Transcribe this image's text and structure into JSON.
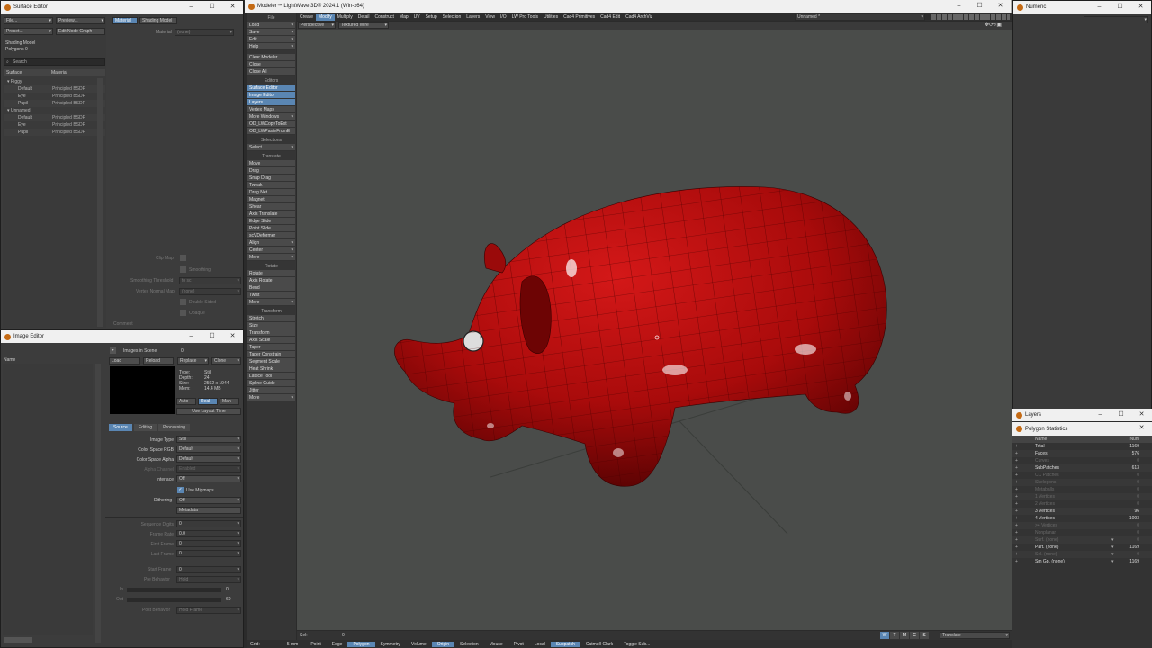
{
  "surface_editor": {
    "title": "Surface Editor",
    "file": "File...",
    "preview": "Preview...",
    "preset": "Preset...",
    "edit_node_graph": "Edit Node Graph",
    "shading_model": "Shading Model",
    "polygons": "Polygons  0",
    "search": "Search",
    "col_surface": "Surface",
    "col_material": "Material",
    "tab_material": "Material",
    "tab_shading": "Shading Model",
    "material_label": "Material",
    "material_value": "(none)",
    "tree": [
      {
        "label": "Piggy",
        "material": "",
        "indent": 0,
        "group": true
      },
      {
        "label": "Default",
        "material": "Principled BSDF",
        "indent": 1
      },
      {
        "label": "Eye",
        "material": "Principled BSDF",
        "indent": 1
      },
      {
        "label": "Pupil",
        "material": "Principled BSDF",
        "indent": 1
      },
      {
        "label": "Unnamed",
        "material": "",
        "indent": 0,
        "group": true
      },
      {
        "label": "Default",
        "material": "Principled BSDF",
        "indent": 1
      },
      {
        "label": "Eye",
        "material": "Principled BSDF",
        "indent": 1
      },
      {
        "label": "Pupil",
        "material": "Principled BSDF",
        "indent": 1
      }
    ],
    "clip_map": "Clip Map",
    "smoothing": "Smoothing",
    "smoothing_threshold": "Smoothing Threshold",
    "smoothing_threshold_val": "to sc",
    "vertex_normal_map": "Vertex Normal Map",
    "vertex_normal_val": "(none)",
    "double_sided": "Double Sided",
    "opaque": "Opaque",
    "comment": "Comment"
  },
  "image_editor": {
    "title": "Image Editor",
    "name_col": "Name",
    "images_in_scene": "Images in Scene",
    "count": "0",
    "load": "Load",
    "reload": "Reload",
    "replace": "Replace",
    "clone": "Clone",
    "type_k": "Type:",
    "type_v": "Still",
    "depth_k": "Depth:",
    "depth_v": "24",
    "size_k": "Size:",
    "size_v": "2592 x 1944",
    "mem_k": "Mem:",
    "mem_v": "14.4 MB",
    "auto": "Auto",
    "real": "Real",
    "man": "Man",
    "use_layout_time": "Use Layout Time",
    "tabs": [
      "Source",
      "Editing",
      "Processing"
    ],
    "fields": [
      {
        "label": "Image Type",
        "value": "Still"
      },
      {
        "label": "Color Space RGB",
        "value": "Default"
      },
      {
        "label": "Color Space Alpha",
        "value": "Default"
      },
      {
        "label": "Alpha Channel",
        "value": "Enabled"
      },
      {
        "label": "Interlace",
        "value": "Off"
      }
    ],
    "use_mipmaps": "Use Mipmaps",
    "dithering": "Dithering",
    "dithering_val": "Off",
    "metadata": "Metadata",
    "seq": [
      {
        "label": "Sequence Digits",
        "value": "0"
      },
      {
        "label": "Frame Rate",
        "value": "0.0"
      },
      {
        "label": "First Frame",
        "value": "0"
      },
      {
        "label": "Last Frame",
        "value": "0"
      }
    ],
    "start_frame": "Start Frame",
    "start_val": "0",
    "pre_behavior": "Pre Behavior",
    "pre_val": "Hold",
    "in_label": "In",
    "in_val": "0",
    "out_label": "Out",
    "out_val": "60",
    "post_behavior": "Post Behavior",
    "post_val": "Hold Frame"
  },
  "modeler": {
    "title": "Modeler™ LightWave 3D® 2024.1 (Win-x64)",
    "menus": [
      {
        "t": "Create"
      },
      {
        "t": "Modify",
        "sel": true
      },
      {
        "t": "Multiply"
      },
      {
        "t": "Detail"
      },
      {
        "t": "Construct"
      },
      {
        "t": "Map"
      },
      {
        "t": "UV"
      },
      {
        "t": "Setup"
      },
      {
        "t": "Selection"
      },
      {
        "t": "Layers"
      },
      {
        "t": "View"
      },
      {
        "t": "I/O"
      },
      {
        "t": "LW Pro Tools"
      },
      {
        "t": "Utilities"
      },
      {
        "t": "Cad4 Primitives"
      },
      {
        "t": "Cad4 Edit"
      },
      {
        "t": "Cad4 ArchViz"
      }
    ],
    "object_name": "Unnamed *",
    "view_mode": "Perspective",
    "shade_mode": "Textured Wire",
    "toolbar": {
      "file": "File",
      "file_items": [
        "Load",
        "Save",
        "Edit",
        "Help"
      ],
      "misc": [
        "Clear Modeler",
        "Close",
        "Close All"
      ],
      "editors_hdr": "Editors",
      "editors": [
        "Surface Editor",
        "Image Editor",
        "Layers",
        "Vertex Maps"
      ],
      "more_windows": "More Windows",
      "plugins": [
        "OD_LWCopyToExt",
        "OD_LWPasteFromE"
      ],
      "selections_hdr": "Selections",
      "select": "Select",
      "translate_hdr": "Translate",
      "translate": [
        "Move",
        "Drag",
        "Snap Drag",
        "Tweak",
        "Drag Net",
        "Magnet",
        "Shear",
        "Axis Translate",
        "Edge Slide",
        "Point Slide",
        "scVDeformer",
        "Align",
        "Center",
        "More"
      ],
      "rotate_hdr": "Rotate",
      "rotate": [
        "Rotate",
        "Axis Rotate",
        "Bend",
        "Twist",
        "More"
      ],
      "transform_hdr": "Transform",
      "transform": [
        "Stretch",
        "Size",
        "Transform",
        "Axis Scale",
        "Taper",
        "Taper Constrain",
        "Segment Scale",
        "Heat Shrink",
        "Lattice Tool",
        "Spline Guide",
        "Jitter",
        "More"
      ]
    },
    "sel_label": "Sel:",
    "sel_val": "0",
    "grid_label": "Grid:",
    "grid_val": "5 mm",
    "bottom": [
      {
        "t": "Point"
      },
      {
        "t": "Edge"
      },
      {
        "t": "Polygon",
        "sel": true
      },
      {
        "t": "Symmetry"
      },
      {
        "t": "Volume"
      },
      {
        "t": "Origin",
        "sel": true
      },
      {
        "t": "Selection"
      },
      {
        "t": "Mouse"
      },
      {
        "t": "Pivot"
      },
      {
        "t": "Local"
      },
      {
        "t": "Subpatch",
        "sel": true
      },
      {
        "t": "Catmull-Clark"
      },
      {
        "t": "Toggle Sub..."
      }
    ],
    "wtmcs": [
      "W",
      "T",
      "M",
      "C",
      "S"
    ],
    "bottom_right": "Translate"
  },
  "numeric": {
    "title": "Numeric"
  },
  "layers": {
    "title": "Layers"
  },
  "poly_stats": {
    "title": "Polygon Statistics",
    "col_name": "Name",
    "col_num": "Num",
    "rows": [
      {
        "n": "Total",
        "v": "1169"
      },
      {
        "n": "Faces",
        "v": "576"
      },
      {
        "n": "Curves",
        "v": "0"
      },
      {
        "n": "SubPatches",
        "v": "613"
      },
      {
        "n": "CC Patches",
        "v": "0"
      },
      {
        "n": "Skelegons",
        "v": "0"
      },
      {
        "n": "Metaballs",
        "v": "0"
      },
      {
        "n": "1 Vertices",
        "v": "0"
      },
      {
        "n": "2 Vertices",
        "v": "0"
      },
      {
        "n": "3 Vertices",
        "v": "96"
      },
      {
        "n": "4 Vertices",
        "v": "1093"
      },
      {
        ">4 Vertices": "",
        "n": ">4 Vertices",
        "v": "0"
      },
      {
        "n": "Nonplanar",
        "v": "0"
      },
      {
        "n": "Surf. (none)",
        "v": "0"
      },
      {
        "n": "Part. (none)",
        "v": "1169"
      },
      {
        "n": "Sel. (none)",
        "v": "0"
      },
      {
        "n": "Sm Gp. (none)",
        "v": "1169"
      }
    ]
  }
}
